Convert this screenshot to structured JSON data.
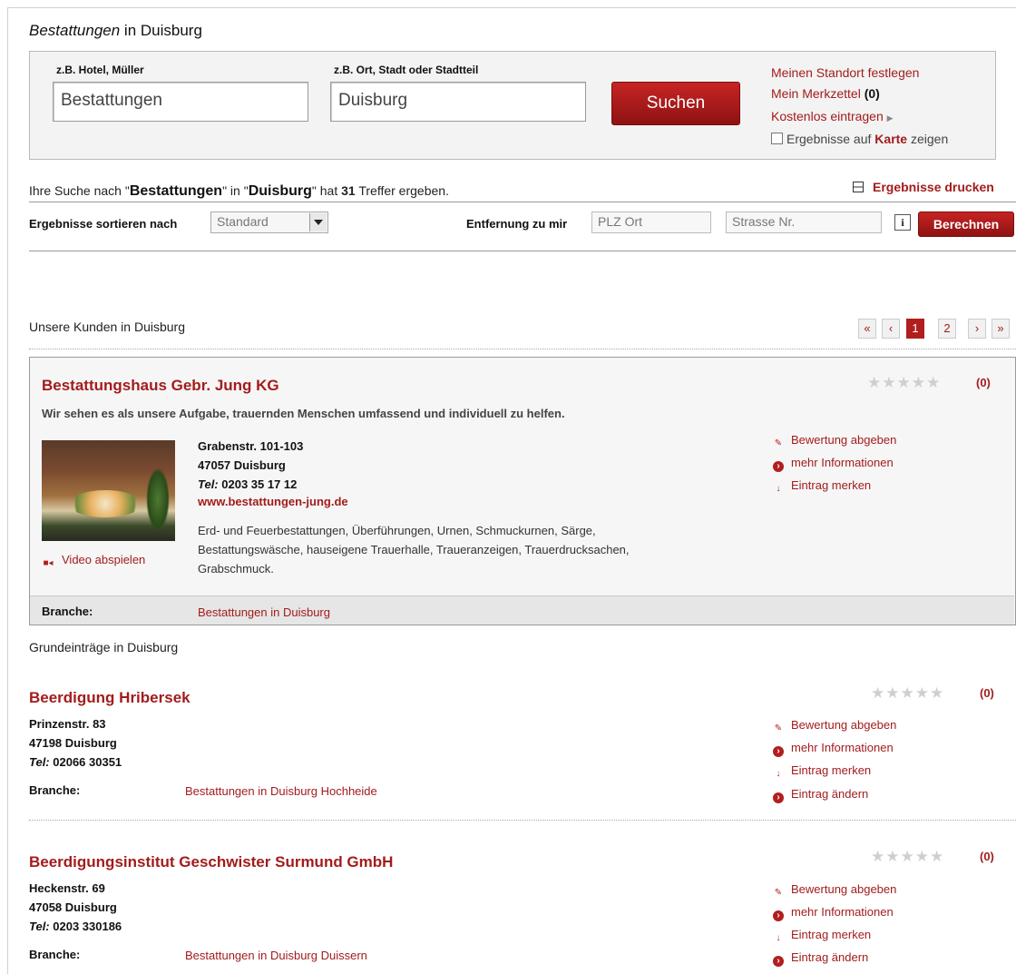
{
  "header": {
    "title_italic": "Bestattungen",
    "title_rest": " in Duisburg"
  },
  "search": {
    "what_label": "z.B. Hotel, Müller",
    "what_value": "Bestattungen",
    "where_label": "z.B. Ort, Stadt oder Stadtteil",
    "where_value": "Duisburg",
    "button": "Suchen",
    "links": {
      "standort": "Meinen Standort festlegen",
      "merkzettel": "Mein Merkzettel",
      "merkzettel_count": "(0)",
      "eintragen": "Kostenlos eintragen",
      "karte_pre": "Ergebnisse auf",
      "karte_mid": "Karte",
      "karte_post": "zeigen"
    }
  },
  "results": {
    "summary_pre": "Ihre Suche nach \"",
    "term": "Bestattungen",
    "summary_mid": "\" in \"",
    "place": "Duisburg",
    "summary_post1": "\" hat ",
    "count": "31",
    "summary_post2": " Treffer ergeben.",
    "print": "Ergebnisse drucken",
    "sort_label": "Ergebnisse sortieren  nach",
    "sort_value": "Standard",
    "distance_label": "Entfernung zu mir",
    "plz_placeholder": "PLZ Ort",
    "street_placeholder": "Strasse Nr.",
    "info": "i",
    "calc": "Berechnen"
  },
  "pagination": [
    "«",
    "‹",
    "1",
    "2",
    "›",
    "»"
  ],
  "sections": {
    "kunden": "Unsere Kunden in Duisburg",
    "grund": "Grundeinträge in Duisburg"
  },
  "featured": {
    "name": "Bestattungshaus Gebr. Jung KG",
    "slogan": "Wir sehen es als unsere Aufgabe, trauernden Menschen umfassend und individuell zu helfen.",
    "street": "Grabenstr. 101-103",
    "city": "47057 Duisburg",
    "tel_label": "Tel:",
    "tel": " 0203 35 17 12",
    "web": "www.bestattungen-jung.de",
    "desc1": "Erd- und Feuerbestattungen, Überführungen, Urnen, Schmuckurnen, Särge,",
    "desc2": "Bestattungswäsche, hauseigene Trauerhalle, Traueranzeigen, Trauerdrucksachen,",
    "desc3": "Grabschmuck.",
    "video": "Video abspielen",
    "branche_label": "Branche:",
    "branche": "Bestattungen in Duisburg",
    "rating": "(0)",
    "actions": [
      "Bewertung abgeben",
      "mehr Informationen",
      "Eintrag merken"
    ]
  },
  "entries": [
    {
      "name": "Beerdigung Hribersek",
      "street": "Prinzenstr. 83",
      "city": "47198 Duisburg",
      "tel_label": "Tel:",
      "tel": " 02066 30351",
      "branche_label": "Branche:",
      "branche": "Bestattungen in Duisburg Hochheide",
      "rating": "(0)",
      "actions": [
        "Bewertung abgeben",
        "mehr Informationen",
        "Eintrag merken",
        "Eintrag ändern"
      ]
    },
    {
      "name": "Beerdigungsinstitut Geschwister Surmund GmbH",
      "street": "Heckenstr. 69",
      "city": "47058 Duisburg",
      "tel_label": "Tel:",
      "tel": " 0203 330186",
      "branche_label": "Branche:",
      "branche": "Bestattungen in Duisburg Duissern",
      "rating": "(0)",
      "actions": [
        "Bewertung abgeben",
        "mehr Informationen",
        "Eintrag merken",
        "Eintrag ändern"
      ]
    }
  ],
  "colors": {
    "accent": "#a31c1c",
    "button": "#b21e1e"
  }
}
